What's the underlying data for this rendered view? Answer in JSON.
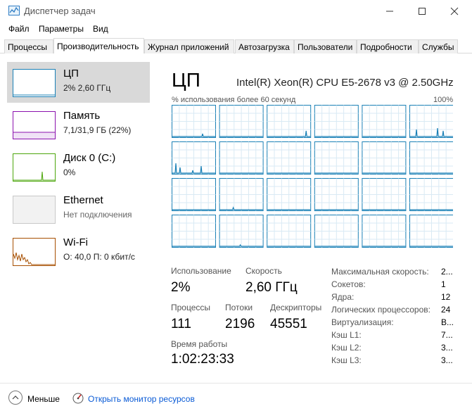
{
  "window": {
    "title": "Диспетчер задач"
  },
  "menu": [
    "Файл",
    "Параметры",
    "Вид"
  ],
  "tabs": [
    {
      "label": "Процессы"
    },
    {
      "label": "Производительность"
    },
    {
      "label": "Журнал приложений"
    },
    {
      "label": "Автозагрузка"
    },
    {
      "label": "Пользователи"
    },
    {
      "label": "Подробности"
    },
    {
      "label": "Службы"
    }
  ],
  "sidebar": [
    {
      "title": "ЦП",
      "sub": "2% 2,60 ГГц",
      "color": "#1a80b6"
    },
    {
      "title": "Память",
      "sub": "7,1/31,9 ГБ (22%)",
      "color": "#8b12ae"
    },
    {
      "title": "Диск 0 (C:)",
      "sub": "0%",
      "color": "#4da60c"
    },
    {
      "title": "Ethernet",
      "sub": "Нет подключения",
      "color": "#a7a7a7"
    },
    {
      "title": "Wi-Fi",
      "sub": "О: 40,0 П: 0 кбит/с",
      "color": "#a74f01"
    }
  ],
  "cpu": {
    "title": "ЦП",
    "model": "Intel(R) Xeon(R) CPU E5-2678 v3 @ 2.50GHz",
    "graph_caption": "% использования более 60 секунд",
    "graph_max": "100%",
    "core_count_shown": 24,
    "accent": "#1a80b6"
  },
  "stats": {
    "usage_label": "Использование",
    "usage_value": "2%",
    "speed_label": "Скорость",
    "speed_value": "2,60 ГГц",
    "processes_label": "Процессы",
    "processes_value": "111",
    "threads_label": "Потоки",
    "threads_value": "2196",
    "handles_label": "Дескрипторы",
    "handles_value": "45551",
    "uptime_label": "Время работы",
    "uptime_value": "1:02:23:33"
  },
  "info": [
    {
      "label": "Максимальная скорость:",
      "value": "2..."
    },
    {
      "label": "Сокетов:",
      "value": "1"
    },
    {
      "label": "Ядра:",
      "value": "12"
    },
    {
      "label": "Логических процессоров:",
      "value": "24"
    },
    {
      "label": "Виртуализация:",
      "value": "В..."
    },
    {
      "label": "Кэш L1:",
      "value": "7..."
    },
    {
      "label": "Кэш L2:",
      "value": "3..."
    },
    {
      "label": "Кэш L3:",
      "value": "3..."
    }
  ],
  "footer": {
    "less_label": "Меньше",
    "monitor_label": "Открыть монитор ресурсов"
  }
}
